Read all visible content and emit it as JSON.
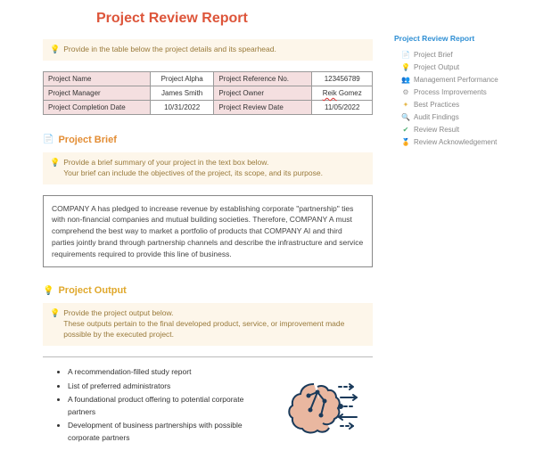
{
  "title": "Project Review Report",
  "hints": {
    "details": "Provide in the table below the project details and its spearhead.",
    "brief_line1": "Provide a brief summary of your project in the text box below.",
    "brief_line2": "Your brief can include the objectives of the project, its scope, and its purpose.",
    "output_line1": "Provide the project output below.",
    "output_line2": "These outputs pertain to the final developed product, service, or improvement made possible by the executed project."
  },
  "details": {
    "r1c1_label": "Project Name",
    "r1c1_val": "Project Alpha",
    "r1c2_label": "Project Reference No.",
    "r1c2_val": "123456789",
    "r2c1_label": "Project Manager",
    "r2c1_val": "James Smith",
    "r2c2_label": "Project Owner",
    "r2c2_val_first": "Reik",
    "r2c2_val_last": " Gomez",
    "r3c1_label": "Project Completion Date",
    "r3c1_val": "10/31/2022",
    "r3c2_label": "Project Review Date",
    "r3c2_val": "11/05/2022"
  },
  "sections": {
    "brief_title": "Project Brief",
    "brief_text": "COMPANY A has pledged to increase revenue by establishing corporate \"partnership\" ties with non-financial companies and mutual building societies. Therefore, COMPANY A must comprehend the best way to market a portfolio of products that COMPANY AI and third parties jointly brand through partnership channels and describe the infrastructure and service requirements required to provide this line of business.",
    "output_title": "Project Output",
    "output_items": [
      "A recommendation-filled study report",
      "List of preferred administrators",
      "A foundational product offering to potential corporate partners",
      "Development of business partnerships with possible corporate partners"
    ]
  },
  "sidebar": {
    "title": "Project Review Report",
    "items": [
      {
        "icon": "📄",
        "label": "Project Brief",
        "color": "#c7a04a"
      },
      {
        "icon": "💡",
        "label": "Project Output",
        "color": "#e7b84c"
      },
      {
        "icon": "👥",
        "label": "Management Performance",
        "color": "#b77b63"
      },
      {
        "icon": "⚙",
        "label": "Process Improvements",
        "color": "#999"
      },
      {
        "icon": "✦",
        "label": "Best Practices",
        "color": "#e6b94b"
      },
      {
        "icon": "🔍",
        "label": "Audit Findings",
        "color": "#d4a94b"
      },
      {
        "icon": "✔",
        "label": "Review Result",
        "color": "#4fb074"
      },
      {
        "icon": "🏅",
        "label": "Review Acknowledgement",
        "color": "#999"
      }
    ]
  }
}
